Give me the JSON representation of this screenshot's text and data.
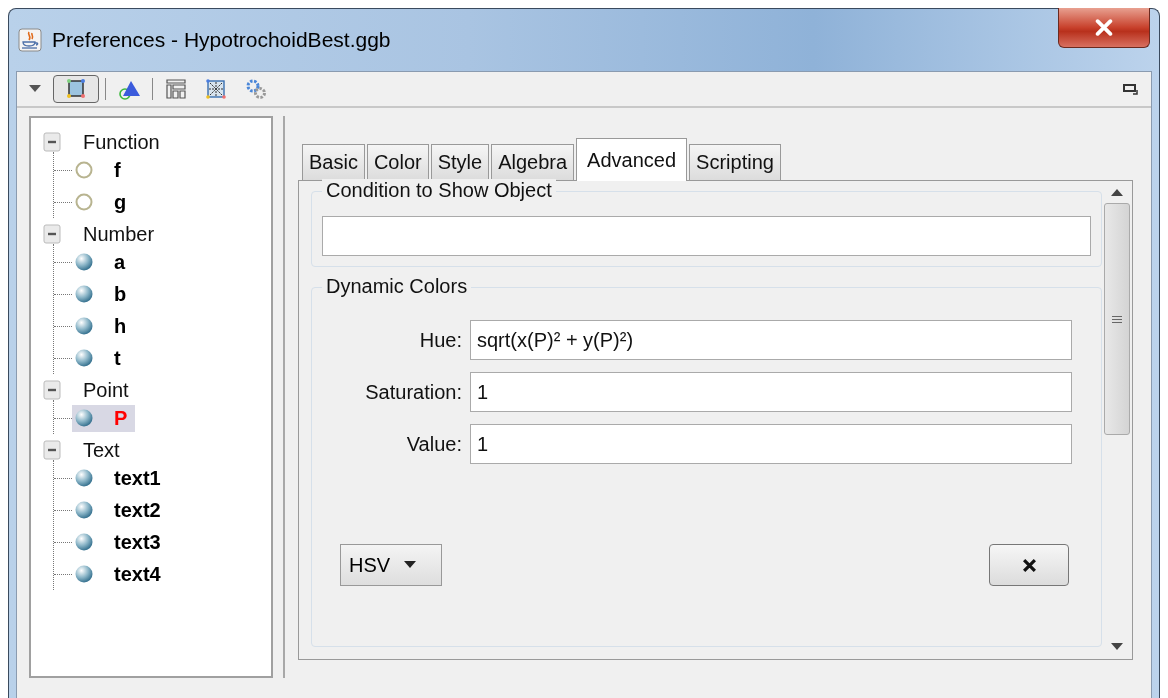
{
  "window": {
    "title": "Preferences - HypotrochoidBest.ggb"
  },
  "toolbar": [
    {
      "kind": "graphics",
      "selected": true
    },
    {
      "kind": "construction",
      "selected": false
    },
    {
      "kind": "layout",
      "selected": false
    },
    {
      "kind": "defaults",
      "selected": false
    },
    {
      "kind": "advanced",
      "selected": false
    }
  ],
  "tree": [
    {
      "label": "Function",
      "expanded": true,
      "children": [
        {
          "label": "f",
          "visible": false,
          "selected": false,
          "color": "#000000"
        },
        {
          "label": "g",
          "visible": false,
          "selected": false,
          "color": "#000000"
        }
      ]
    },
    {
      "label": "Number",
      "expanded": true,
      "children": [
        {
          "label": "a",
          "visible": true,
          "selected": false,
          "color": "#000000"
        },
        {
          "label": "b",
          "visible": true,
          "selected": false,
          "color": "#000000"
        },
        {
          "label": "h",
          "visible": true,
          "selected": false,
          "color": "#000000"
        },
        {
          "label": "t",
          "visible": true,
          "selected": false,
          "color": "#000000"
        }
      ]
    },
    {
      "label": "Point",
      "expanded": true,
      "children": [
        {
          "label": "P",
          "visible": true,
          "selected": true,
          "color": "#ff0000"
        }
      ]
    },
    {
      "label": "Text",
      "expanded": true,
      "children": [
        {
          "label": "text1",
          "visible": true,
          "selected": false,
          "color": "#000000"
        },
        {
          "label": "text2",
          "visible": true,
          "selected": false,
          "color": "#000000"
        },
        {
          "label": "text3",
          "visible": true,
          "selected": false,
          "color": "#000000"
        },
        {
          "label": "text4",
          "visible": true,
          "selected": false,
          "color": "#000000"
        }
      ]
    }
  ],
  "tabs": [
    {
      "label": "Basic",
      "selected": false
    },
    {
      "label": "Color",
      "selected": false
    },
    {
      "label": "Style",
      "selected": false
    },
    {
      "label": "Algebra",
      "selected": false
    },
    {
      "label": "Advanced",
      "selected": true
    },
    {
      "label": "Scripting",
      "selected": false
    }
  ],
  "condition": {
    "label": "Condition to Show Object"
  },
  "dynamic_colors": {
    "label": "Dynamic Colors",
    "fields": [
      {
        "label": "Hue:",
        "value": "sqrt(x(P)² + y(P)²)"
      },
      {
        "label": "Saturation:",
        "value": "1"
      },
      {
        "label": "Value:",
        "value": "1"
      }
    ],
    "model": "HSV"
  }
}
